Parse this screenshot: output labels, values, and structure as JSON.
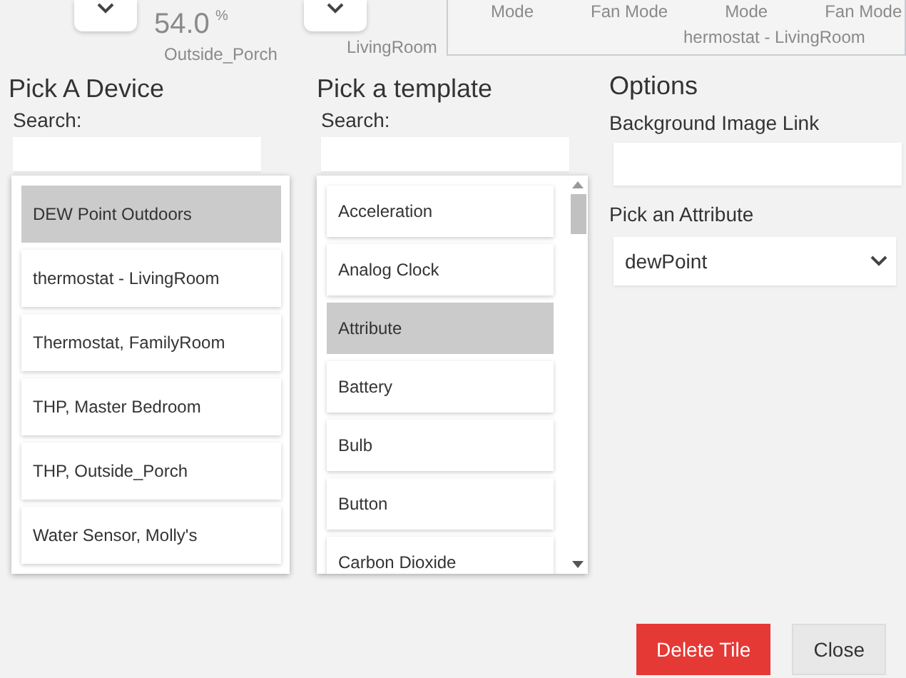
{
  "background_dashboard": {
    "reading": "54.0",
    "unit": "%",
    "mode_labels": [
      "Mode",
      "Fan Mode",
      "Mode",
      "Fan Mode"
    ],
    "tile_labels": [
      "Outside_Porch",
      "LivingRoom",
      "hermostat - LivingRoom"
    ]
  },
  "device_picker": {
    "title": "Pick A Device",
    "search_label": "Search:",
    "items": [
      {
        "label": "DEW Point Outdoors",
        "selected": true
      },
      {
        "label": "thermostat - LivingRoom",
        "selected": false
      },
      {
        "label": "Thermostat, FamilyRoom",
        "selected": false
      },
      {
        "label": "THP, Master Bedroom",
        "selected": false
      },
      {
        "label": "THP, Outside_Porch",
        "selected": false
      },
      {
        "label": "Water Sensor, Molly's",
        "selected": false
      }
    ]
  },
  "template_picker": {
    "title": "Pick a template",
    "search_label": "Search:",
    "items": [
      {
        "label": "Acceleration",
        "selected": false
      },
      {
        "label": "Analog Clock",
        "selected": false
      },
      {
        "label": "Attribute",
        "selected": true
      },
      {
        "label": "Battery",
        "selected": false
      },
      {
        "label": "Bulb",
        "selected": false
      },
      {
        "label": "Button",
        "selected": false
      },
      {
        "label": "Carbon Dioxide",
        "selected": false
      }
    ]
  },
  "options": {
    "title": "Options",
    "background_image_label": "Background Image Link",
    "attribute_label": "Pick an Attribute",
    "attribute_value": "dewPoint"
  },
  "buttons": [
    {
      "label": "Delete Tile",
      "kind": "danger"
    },
    {
      "label": "Close",
      "kind": "plain"
    }
  ]
}
